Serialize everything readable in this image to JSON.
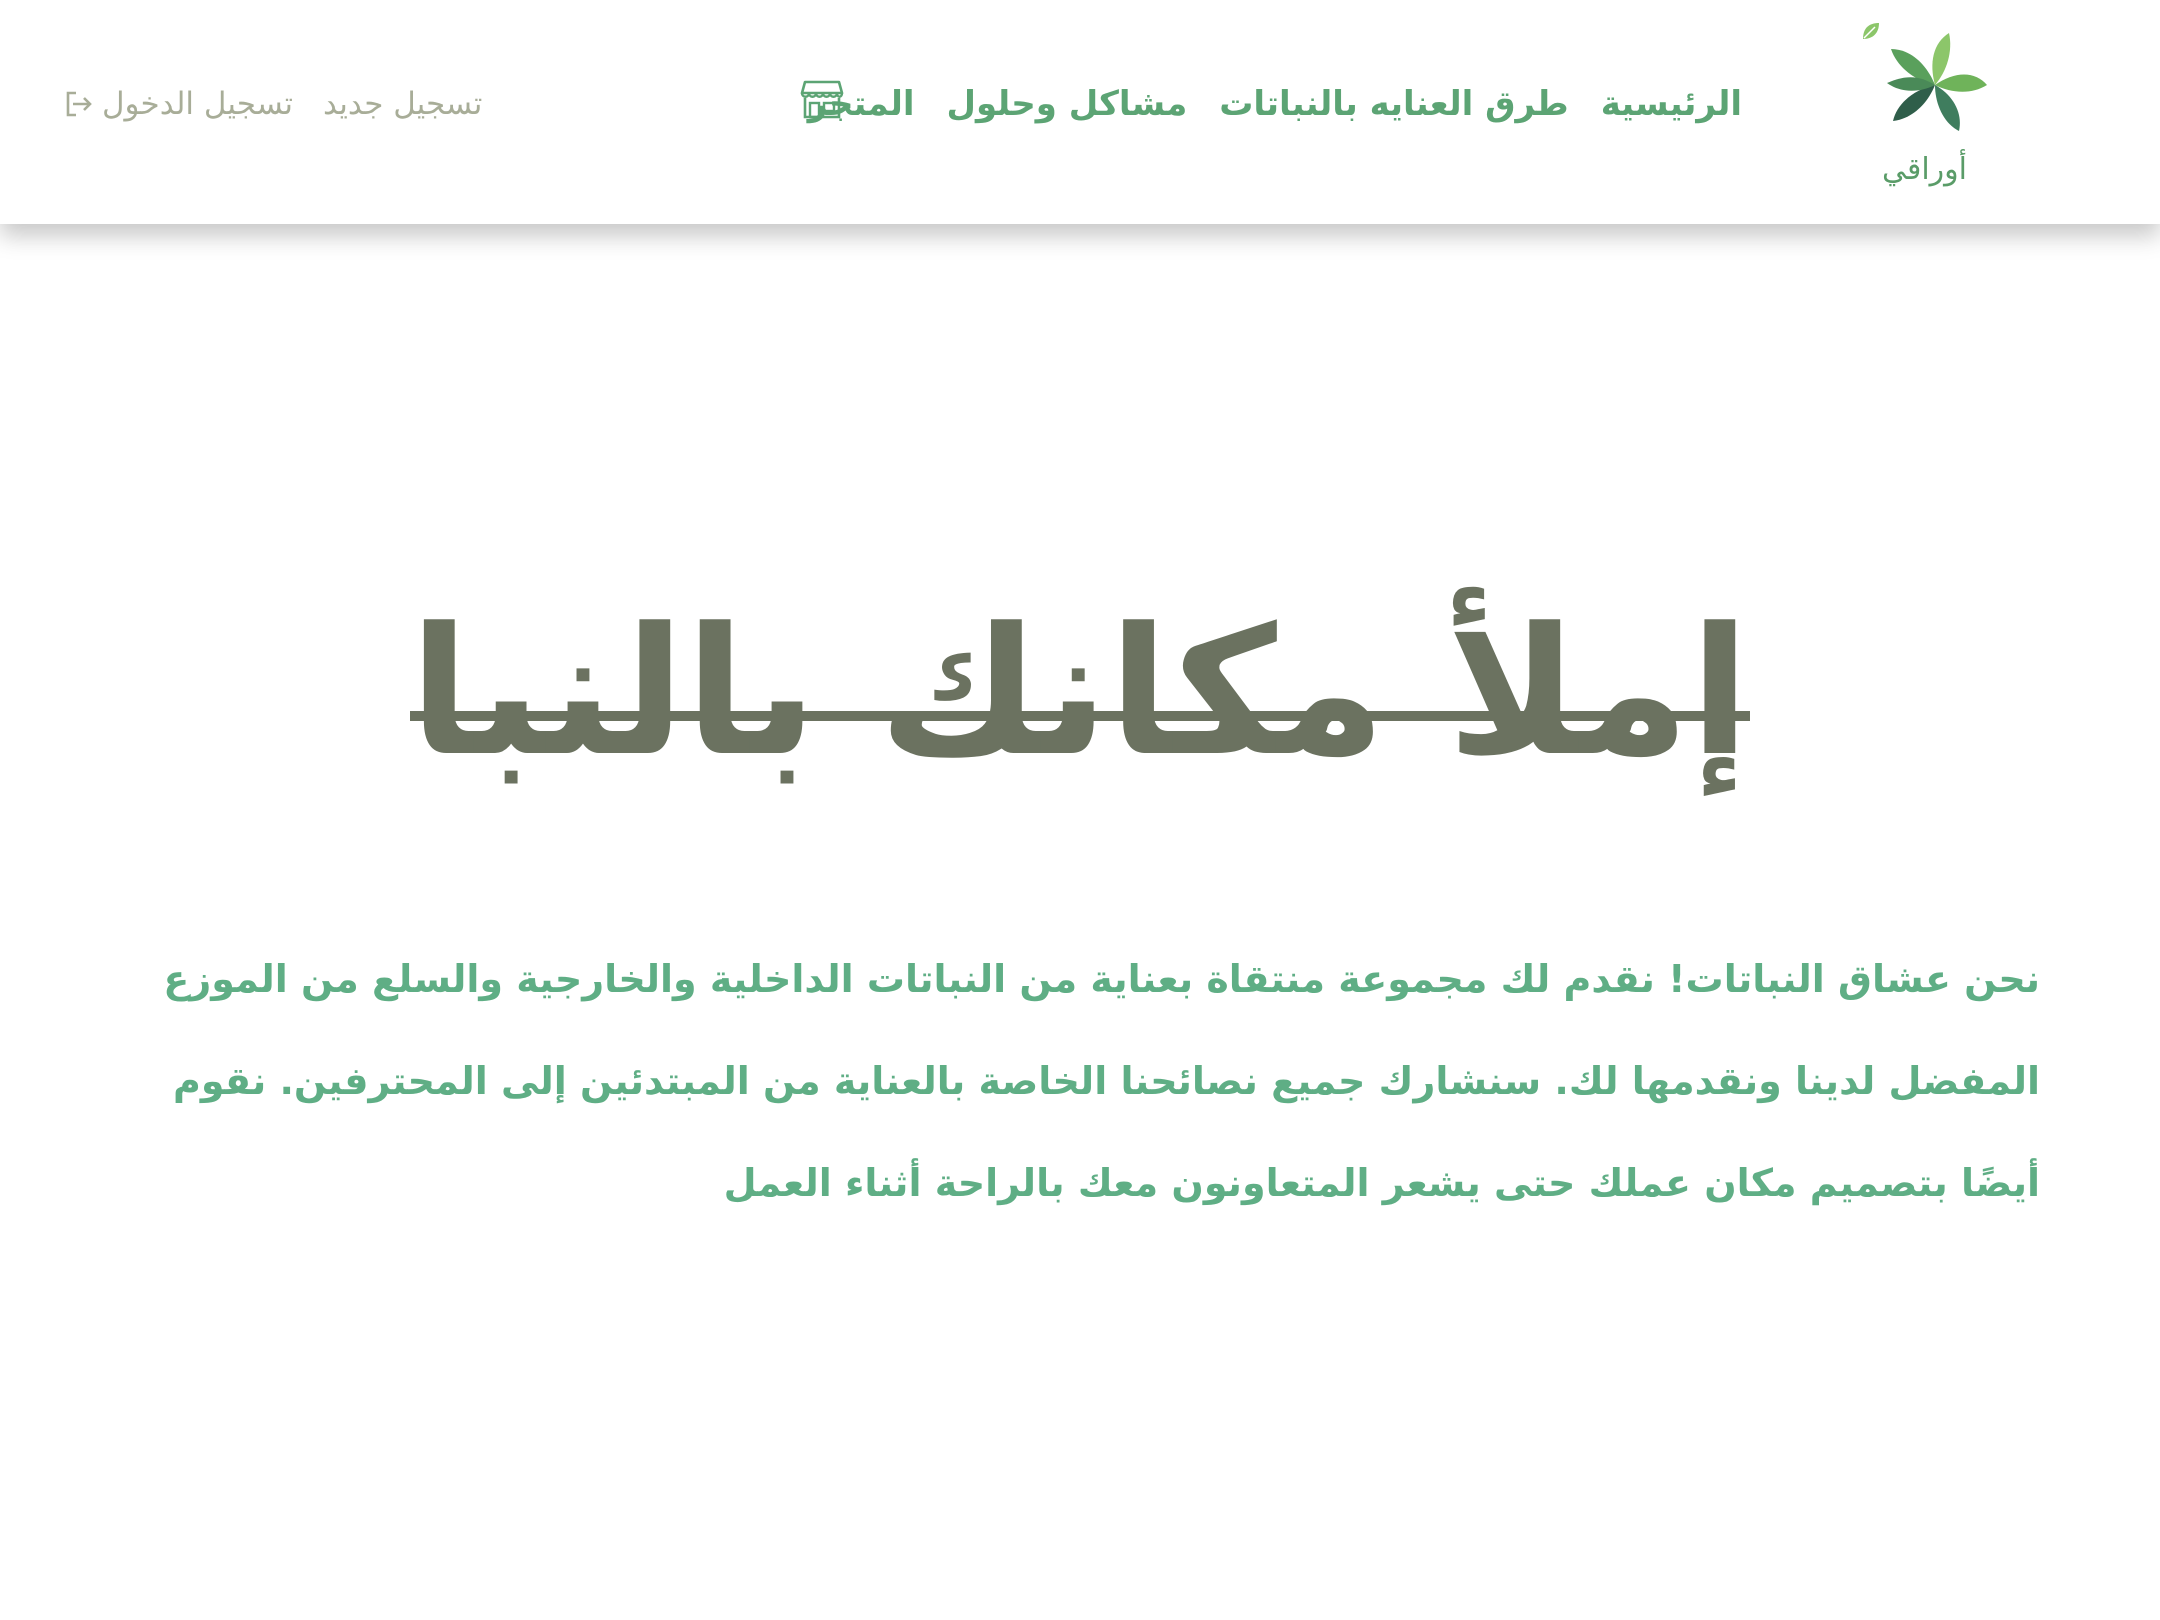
{
  "header": {
    "logo": {
      "text": "أوراقي",
      "icon": "leaf-pinwheel-icon"
    },
    "nav": {
      "items": [
        {
          "label": "الرئيسية"
        },
        {
          "label": "طرق العنايه بالنباتات"
        },
        {
          "label": "مشاكل وحلول"
        },
        {
          "label": "المتجر"
        }
      ],
      "store_icon": "store-icon"
    },
    "auth": {
      "register_label": "تسجيل جديد",
      "login_label": "تسجيل الدخول",
      "login_icon": "login-icon"
    }
  },
  "hero": {
    "title": "إملأ مكانك بالنباتات"
  },
  "intro": {
    "text": "نحن عشاق النباتات! نقدم لك مجموعة منتقاة بعناية من النباتات الداخلية والخارجية والسلع من الموزع المفضل لدينا ونقدمها لك. سنشارك جميع نصائحنا الخاصة بالعناية من المبتدئين إلى المحترفين. نقوم أيضًا بتصميم مكان عملك حتى يشعر المتعاونون معك بالراحة أثناء العمل"
  },
  "colors": {
    "nav_green": "#5ca474",
    "paragraph_green": "#5fae85",
    "title_olive": "#6b7260",
    "auth_gray": "#a8ad98",
    "logo_dark": "#2f5e4a",
    "logo_light": "#8cc66a"
  }
}
